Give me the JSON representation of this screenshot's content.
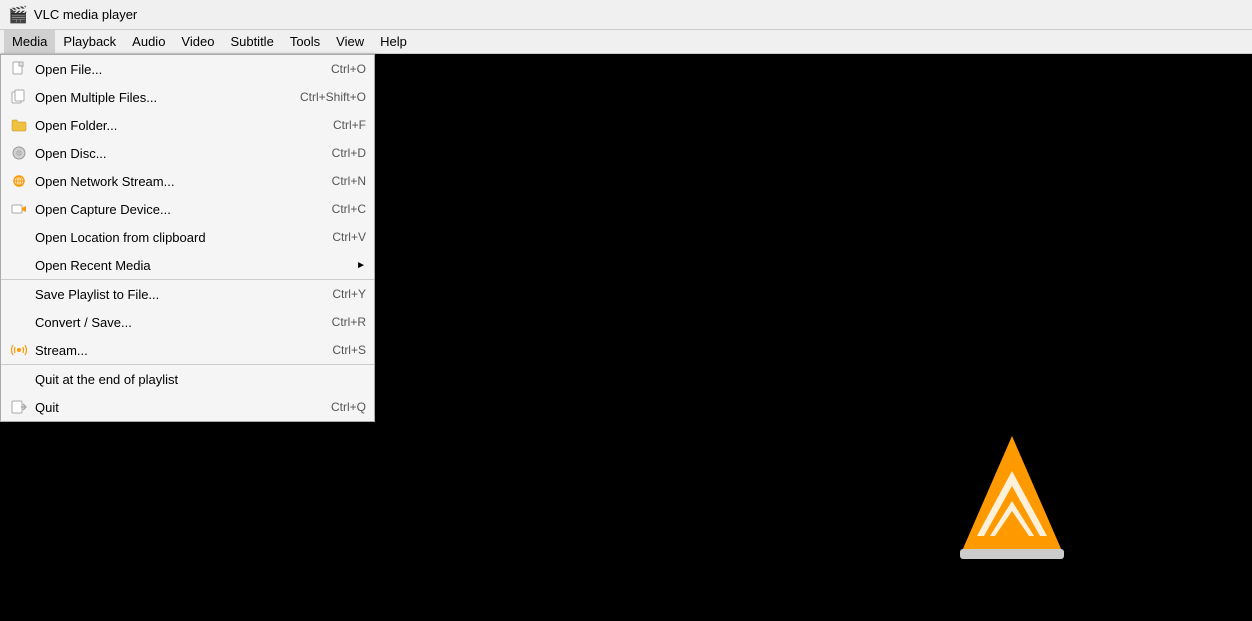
{
  "titlebar": {
    "icon": "vlc-icon",
    "title": "VLC media player"
  },
  "menubar": {
    "items": [
      {
        "id": "media",
        "label": "Media",
        "active": true
      },
      {
        "id": "playback",
        "label": "Playback"
      },
      {
        "id": "audio",
        "label": "Audio"
      },
      {
        "id": "video",
        "label": "Video"
      },
      {
        "id": "subtitle",
        "label": "Subtitle"
      },
      {
        "id": "tools",
        "label": "Tools"
      },
      {
        "id": "view",
        "label": "View"
      },
      {
        "id": "help",
        "label": "Help"
      }
    ]
  },
  "media_menu": {
    "items": [
      {
        "id": "open-file",
        "label": "Open File...",
        "shortcut": "Ctrl+O",
        "icon": "file-icon",
        "separator_before": false
      },
      {
        "id": "open-multiple",
        "label": "Open Multiple Files...",
        "shortcut": "Ctrl+Shift+O",
        "icon": "multi-file-icon",
        "separator_before": false
      },
      {
        "id": "open-folder",
        "label": "Open Folder...",
        "shortcut": "Ctrl+F",
        "icon": "folder-icon",
        "separator_before": false
      },
      {
        "id": "open-disc",
        "label": "Open Disc...",
        "shortcut": "Ctrl+D",
        "icon": "disc-icon",
        "separator_before": false
      },
      {
        "id": "open-network",
        "label": "Open Network Stream...",
        "shortcut": "Ctrl+N",
        "icon": "network-icon",
        "separator_before": false
      },
      {
        "id": "open-capture",
        "label": "Open Capture Device...",
        "shortcut": "Ctrl+C",
        "icon": "capture-icon",
        "separator_before": false
      },
      {
        "id": "open-location",
        "label": "Open Location from clipboard",
        "shortcut": "Ctrl+V",
        "icon": "",
        "separator_before": false
      },
      {
        "id": "open-recent",
        "label": "Open Recent Media",
        "shortcut": "",
        "icon": "",
        "separator_before": false,
        "has_arrow": true
      },
      {
        "id": "save-playlist",
        "label": "Save Playlist to File...",
        "shortcut": "Ctrl+Y",
        "icon": "",
        "separator_before": true
      },
      {
        "id": "convert-save",
        "label": "Convert / Save...",
        "shortcut": "Ctrl+R",
        "icon": "",
        "separator_before": false
      },
      {
        "id": "stream",
        "label": "Stream...",
        "shortcut": "Ctrl+S",
        "icon": "stream-icon",
        "separator_before": false
      },
      {
        "id": "quit-end",
        "label": "Quit at the end of playlist",
        "shortcut": "",
        "icon": "",
        "separator_before": true
      },
      {
        "id": "quit",
        "label": "Quit",
        "shortcut": "Ctrl+Q",
        "icon": "quit-icon",
        "separator_before": false
      }
    ]
  }
}
